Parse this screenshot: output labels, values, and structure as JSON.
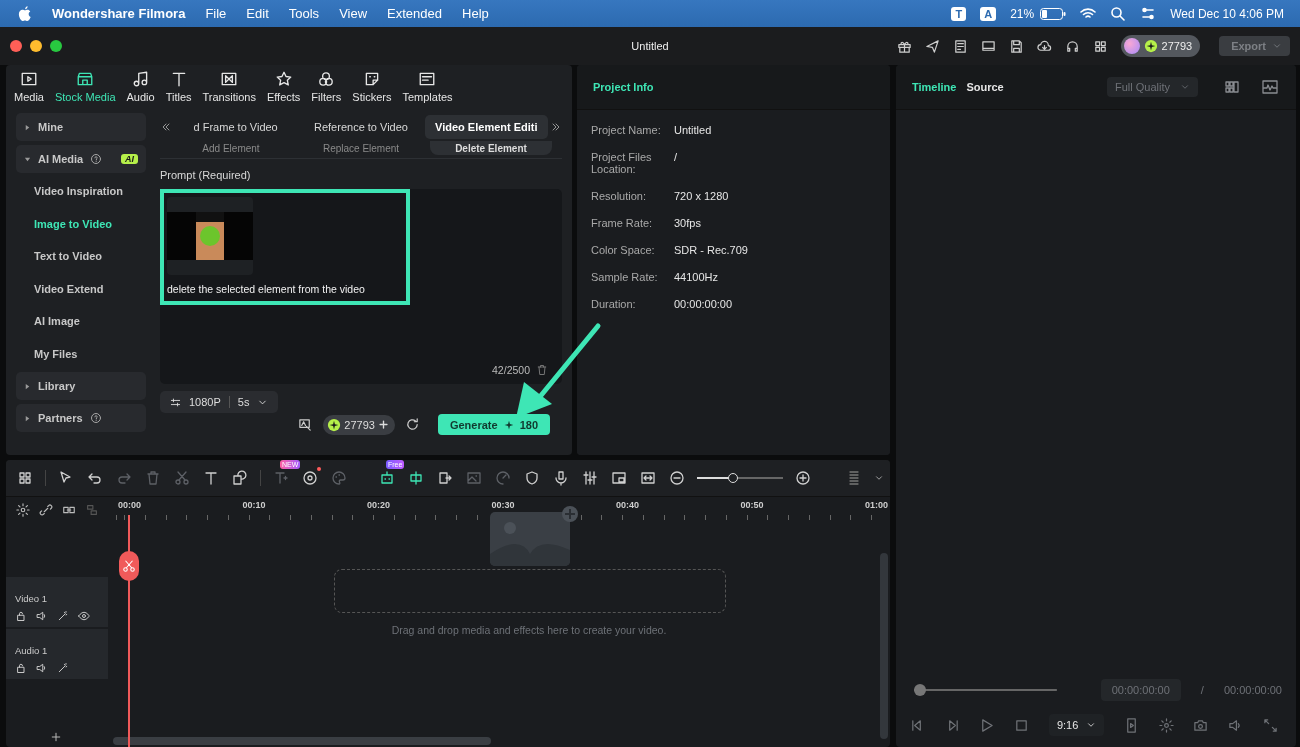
{
  "menubar": {
    "app": "Wondershare Filmora",
    "menus": [
      "File",
      "Edit",
      "Tools",
      "View",
      "Extended",
      "Help"
    ],
    "input_badges": [
      "T",
      "A"
    ],
    "battery": "21%",
    "datetime": "Wed Dec 10  4:06 PM"
  },
  "window": {
    "title": "Untitled",
    "credits": "27793",
    "export": {
      "label": "Export",
      "disabled": true
    }
  },
  "media_tabs": [
    {
      "kind": "media",
      "label": "Media",
      "selected": false
    },
    {
      "kind": "stock",
      "label": "Stock Media",
      "selected": true
    },
    {
      "kind": "audio",
      "label": "Audio",
      "selected": false
    },
    {
      "kind": "titles",
      "label": "Titles",
      "selected": false
    },
    {
      "kind": "transitions",
      "label": "Transitions",
      "selected": false
    },
    {
      "kind": "effects",
      "label": "Effects",
      "selected": false
    },
    {
      "kind": "filters",
      "label": "Filters",
      "selected": false
    },
    {
      "kind": "stickers",
      "label": "Stickers",
      "selected": false
    },
    {
      "kind": "templates",
      "label": "Templates",
      "selected": false
    }
  ],
  "sidebar": [
    {
      "label": "Mine",
      "expanded": false,
      "help": false
    },
    {
      "label": "AI Media",
      "expanded": true,
      "help": true,
      "badge": "AI",
      "children": [
        {
          "label": "Video Inspiration",
          "selected": false
        },
        {
          "label": "Image to Video",
          "selected": true
        },
        {
          "label": "Text to Video",
          "selected": false
        },
        {
          "label": "Video Extend",
          "selected": false
        },
        {
          "label": "AI Image",
          "selected": false
        },
        {
          "label": "My Files",
          "selected": false
        }
      ]
    },
    {
      "label": "Library",
      "expanded": false,
      "help": false
    },
    {
      "label": "Partners",
      "expanded": false,
      "help": true
    }
  ],
  "ai_tabs": [
    {
      "label": "d Frame to Video",
      "selected": false
    },
    {
      "label": "Reference to Video",
      "selected": false
    },
    {
      "label": "Video Element Editi",
      "selected": true
    }
  ],
  "element_tabs": [
    {
      "label": "Add Element",
      "selected": false
    },
    {
      "label": "Replace Element",
      "selected": false
    },
    {
      "label": "Delete Element",
      "selected": true
    }
  ],
  "prompt": {
    "label": "Prompt (Required)",
    "text": "delete the selected element from the video",
    "counter": "42/2500",
    "highlighted": true
  },
  "options": {
    "resolution": "1080P",
    "duration": "5s"
  },
  "credits": "27793",
  "generate": {
    "label": "Generate",
    "cost": "180"
  },
  "project_info": {
    "title": "Project Info",
    "rows": [
      {
        "label": "Project Name:",
        "value": "Untitled"
      },
      {
        "label": "Project Files Location:",
        "value": "/"
      },
      {
        "label": "Resolution:",
        "value": "720 x 1280"
      },
      {
        "label": "Frame Rate:",
        "value": "30fps"
      },
      {
        "label": "Color Space:",
        "value": "SDR - Rec.709"
      },
      {
        "label": "Sample Rate:",
        "value": "44100Hz"
      },
      {
        "label": "Duration:",
        "value": "00:00:00:00"
      }
    ]
  },
  "preview": {
    "tabs": [
      {
        "label": "Timeline",
        "selected": true
      },
      {
        "label": "Source",
        "selected": false
      }
    ],
    "quality": "Full Quality",
    "position": {
      "level": 0
    },
    "current_time": "00:00:00:00",
    "separator": "/",
    "total_time": "00:00:00:00",
    "ratio": "9:16"
  },
  "timeline": {
    "tools_left": [
      {
        "kind": "layout",
        "disabled": false
      },
      {
        "kind": "select",
        "disabled": false
      },
      {
        "kind": "undo",
        "disabled": false
      },
      {
        "kind": "redo",
        "disabled": true
      },
      {
        "kind": "delete",
        "disabled": true
      },
      {
        "kind": "cut",
        "disabled": true
      },
      {
        "kind": "text",
        "disabled": false
      },
      {
        "kind": "shape",
        "disabled": false
      },
      {
        "kind": "ai-text",
        "disabled": true,
        "badge": "NEW"
      },
      {
        "kind": "ai-portrait",
        "disabled": false
      },
      {
        "kind": "palette",
        "disabled": true
      }
    ],
    "tools_right": [
      {
        "kind": "robot",
        "disabled": false,
        "accent": true,
        "badge": "Free"
      },
      {
        "kind": "scan",
        "disabled": false,
        "accent": true
      },
      {
        "kind": "export",
        "disabled": false,
        "accent": false
      },
      {
        "kind": "image",
        "disabled": true,
        "accent": false
      },
      {
        "kind": "speed",
        "disabled": true,
        "accent": false
      },
      {
        "kind": "shield",
        "disabled": false,
        "accent": false
      },
      {
        "kind": "mic",
        "disabled": false,
        "accent": false
      },
      {
        "kind": "mixer",
        "disabled": false,
        "accent": false
      },
      {
        "kind": "pip",
        "disabled": false,
        "accent": false
      },
      {
        "kind": "fit",
        "disabled": false,
        "accent": false
      },
      {
        "kind": "zoom-out",
        "disabled": false,
        "accent": false
      }
    ],
    "zoom": {
      "level": 0.42
    },
    "ruler": [
      "00:00",
      "00:10",
      "00:20",
      "00:30",
      "00:40",
      "00:50",
      "01:00"
    ],
    "tracks": [
      {
        "kind": "video",
        "label": "Video 1"
      },
      {
        "kind": "audio",
        "label": "Audio 1"
      }
    ],
    "drop_hint": "Drag and drop media and effects here to create your video."
  }
}
